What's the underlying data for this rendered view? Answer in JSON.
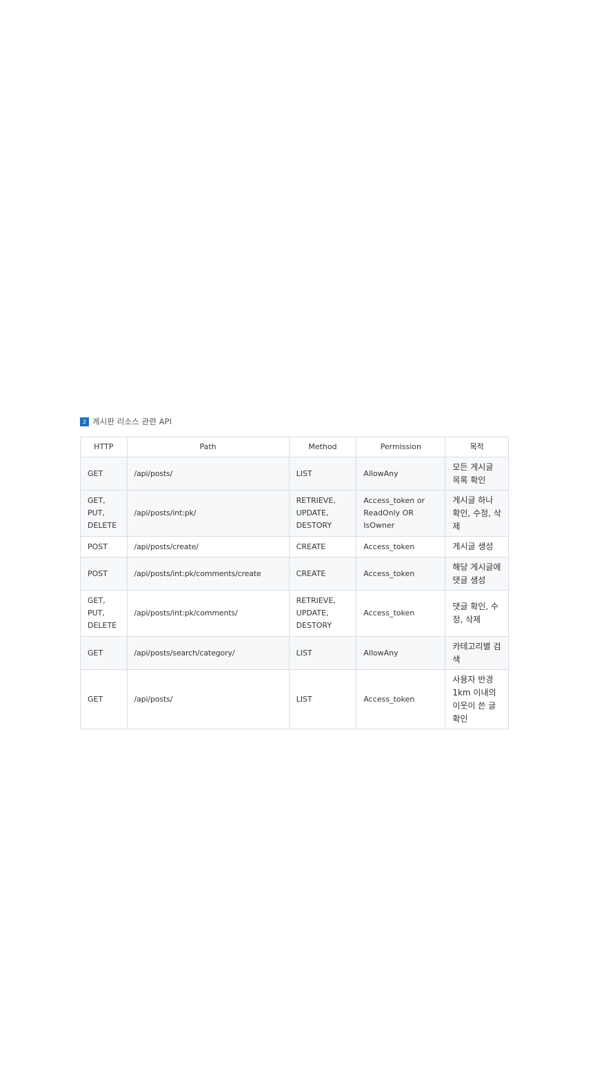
{
  "section": {
    "number": "2",
    "title": "게시판 리소스 관련 API"
  },
  "table": {
    "headers": [
      "HTTP",
      "Path",
      "Method",
      "Permission",
      "목적"
    ],
    "rows": [
      {
        "http": "GET",
        "path": "/api/posts/",
        "method": "LIST",
        "permission": "AllowAny",
        "purpose": "모든 게시글 목록 확인"
      },
      {
        "http": "GET, PUT, DELETE",
        "path": "/api/posts/int:pk/",
        "method": "RETRIEVE, UPDATE, DESTORY",
        "permission": "Access_token or ReadOnly OR IsOwner",
        "purpose": "게시글 하나 확인, 수정, 삭제"
      },
      {
        "http": "POST",
        "path": "/api/posts/create/",
        "method": "CREATE",
        "permission": "Access_token",
        "purpose": "게시글 생성"
      },
      {
        "http": "POST",
        "path": "/api/posts/int:pk/comments/create",
        "method": "CREATE",
        "permission": "Access_token",
        "purpose": "해당 게시글에 댓글 생성"
      },
      {
        "http": "GET, PUT, DELETE",
        "path": "/api/posts/int:pk/comments/",
        "method": "RETRIEVE, UPDATE, DESTORY",
        "permission": "Access_token",
        "purpose": "댓글 확인, 수정, 삭제"
      },
      {
        "http": "GET",
        "path": "/api/posts/search/category/",
        "method": "LIST",
        "permission": "AllowAny",
        "purpose": "카테고리별 검색"
      },
      {
        "http": "GET",
        "path": "/api/posts/",
        "method": "LIST",
        "permission": "Access_token",
        "purpose": "사용자 반경 1km 이내의 이웃이 쓴 글 확인"
      }
    ]
  },
  "colors": {
    "badge": "#1f6fc0",
    "border": "#d8dde3",
    "alt_row": "#f6f8fa"
  }
}
